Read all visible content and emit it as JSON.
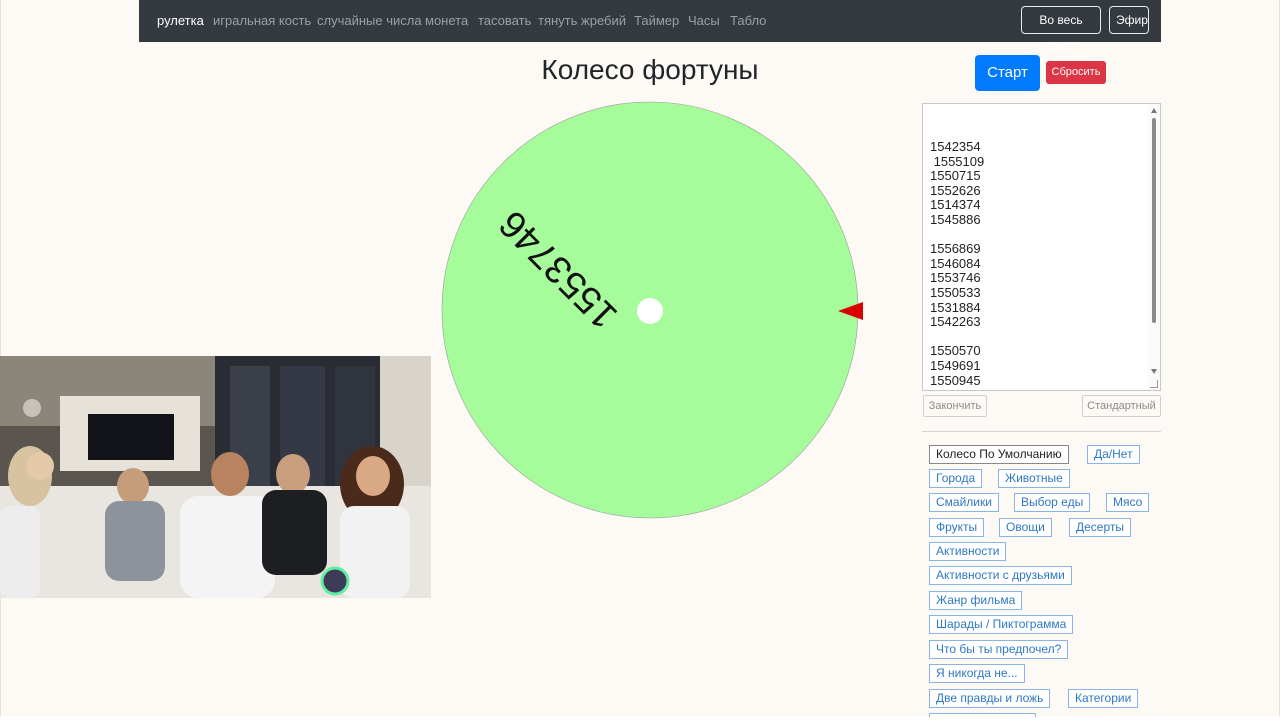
{
  "nav": {
    "items": [
      "рулетка",
      "игральная кость",
      "случайные числа",
      "монета",
      "тасовать",
      "тянуть жребий",
      "Таймер",
      "Часы",
      "Табло"
    ],
    "fullscreen_label": "Во весь экран",
    "live_label": "Эфир"
  },
  "title": "Колесо фортуны",
  "controls": {
    "start_label": "Старт",
    "reset_label": "Сбросить"
  },
  "wheel": {
    "color": "#a6fb9a",
    "pointer_color": "#d80000",
    "segment_label": "1553746"
  },
  "entries": {
    "text": "1542354\n 1555109\n1550715\n1552626\n1514374\n1545886\n\n1556869\n1546084\n1553746\n1550533\n1531884\n1542263\n\n1550570\n1549691\n1550945"
  },
  "entry_buttons": {
    "finish_label": "Закончить",
    "standard_label": "Стандартный"
  },
  "presets": {
    "p0": "Колесо По Умолчанию",
    "p1": "Да/Нет",
    "p2": "Города",
    "p3": "Животные",
    "p4": "Смайлики",
    "p5": "Выбор еды",
    "p6": "Мясо",
    "p7": "Фрукты",
    "p8": "Овощи",
    "p9": "Десерты",
    "p10": "Активности",
    "p11": "Активности с друзьями",
    "p12": "Жанр фильма",
    "p13": "Шарады / Пиктограмма",
    "p14": "Что бы ты предпочел?",
    "p15": "Я никогда не...",
    "p16": "Две правды и ложь",
    "p17": "Категории"
  }
}
